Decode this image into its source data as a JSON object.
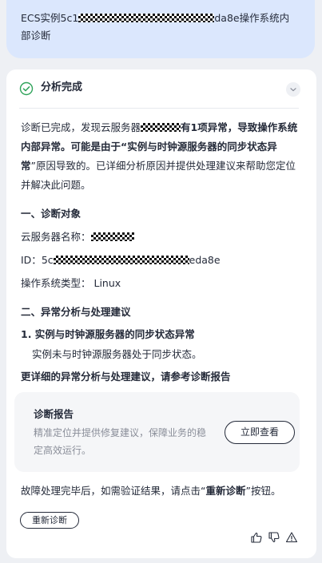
{
  "user_message": {
    "prefix": "ECS实例5c1",
    "suffix_line1": "da8e操作系统内",
    "line2": "部诊断"
  },
  "card": {
    "status_title": "分析完成",
    "summary": {
      "part1": "诊断已完成，发现云服务器",
      "bold1": "有1项异常，导致操作系统内部异常。可能是由于“实例与时钟源服务器的同步状态异常",
      "part2": "”原因导致的。已详细分析原因并提供处理建议来帮助您定位并解决此问题。"
    },
    "section1_title": "一、诊断对象",
    "server_name_label": "云服务器名称：",
    "id_label": "ID：",
    "id_prefix": "5c",
    "id_suffix": "eda8e",
    "os_label": "操作系统类型：",
    "os_value": "Linux",
    "section2_title": "二、异常分析与处理建议",
    "issue_title": "1. 实例与时钟源服务器的同步状态异常",
    "issue_detail": "实例未与时钟源服务器处于同步状态。",
    "more_text": "更详细的异常分析与处理建议，请参考诊断报告",
    "report": {
      "title": "诊断报告",
      "desc": "精准定位并提供修复建议，保障业务的稳定高效运行。",
      "button": "立即查看"
    },
    "after": {
      "part1": "故障处理完毕后，如需验证结果，请点击“",
      "bold": "重新诊断",
      "part2": "”按钮。"
    },
    "rediag_button": "重新诊断"
  },
  "icons": {
    "status": "check-circle-icon",
    "collapse": "chevron-down-icon",
    "like": "thumbs-up-icon",
    "dislike": "thumbs-down-icon",
    "report": "warning-icon"
  },
  "colors": {
    "success": "#2fa35a",
    "user_bubble": "#dbe7fd",
    "background": "#eef0f4"
  }
}
